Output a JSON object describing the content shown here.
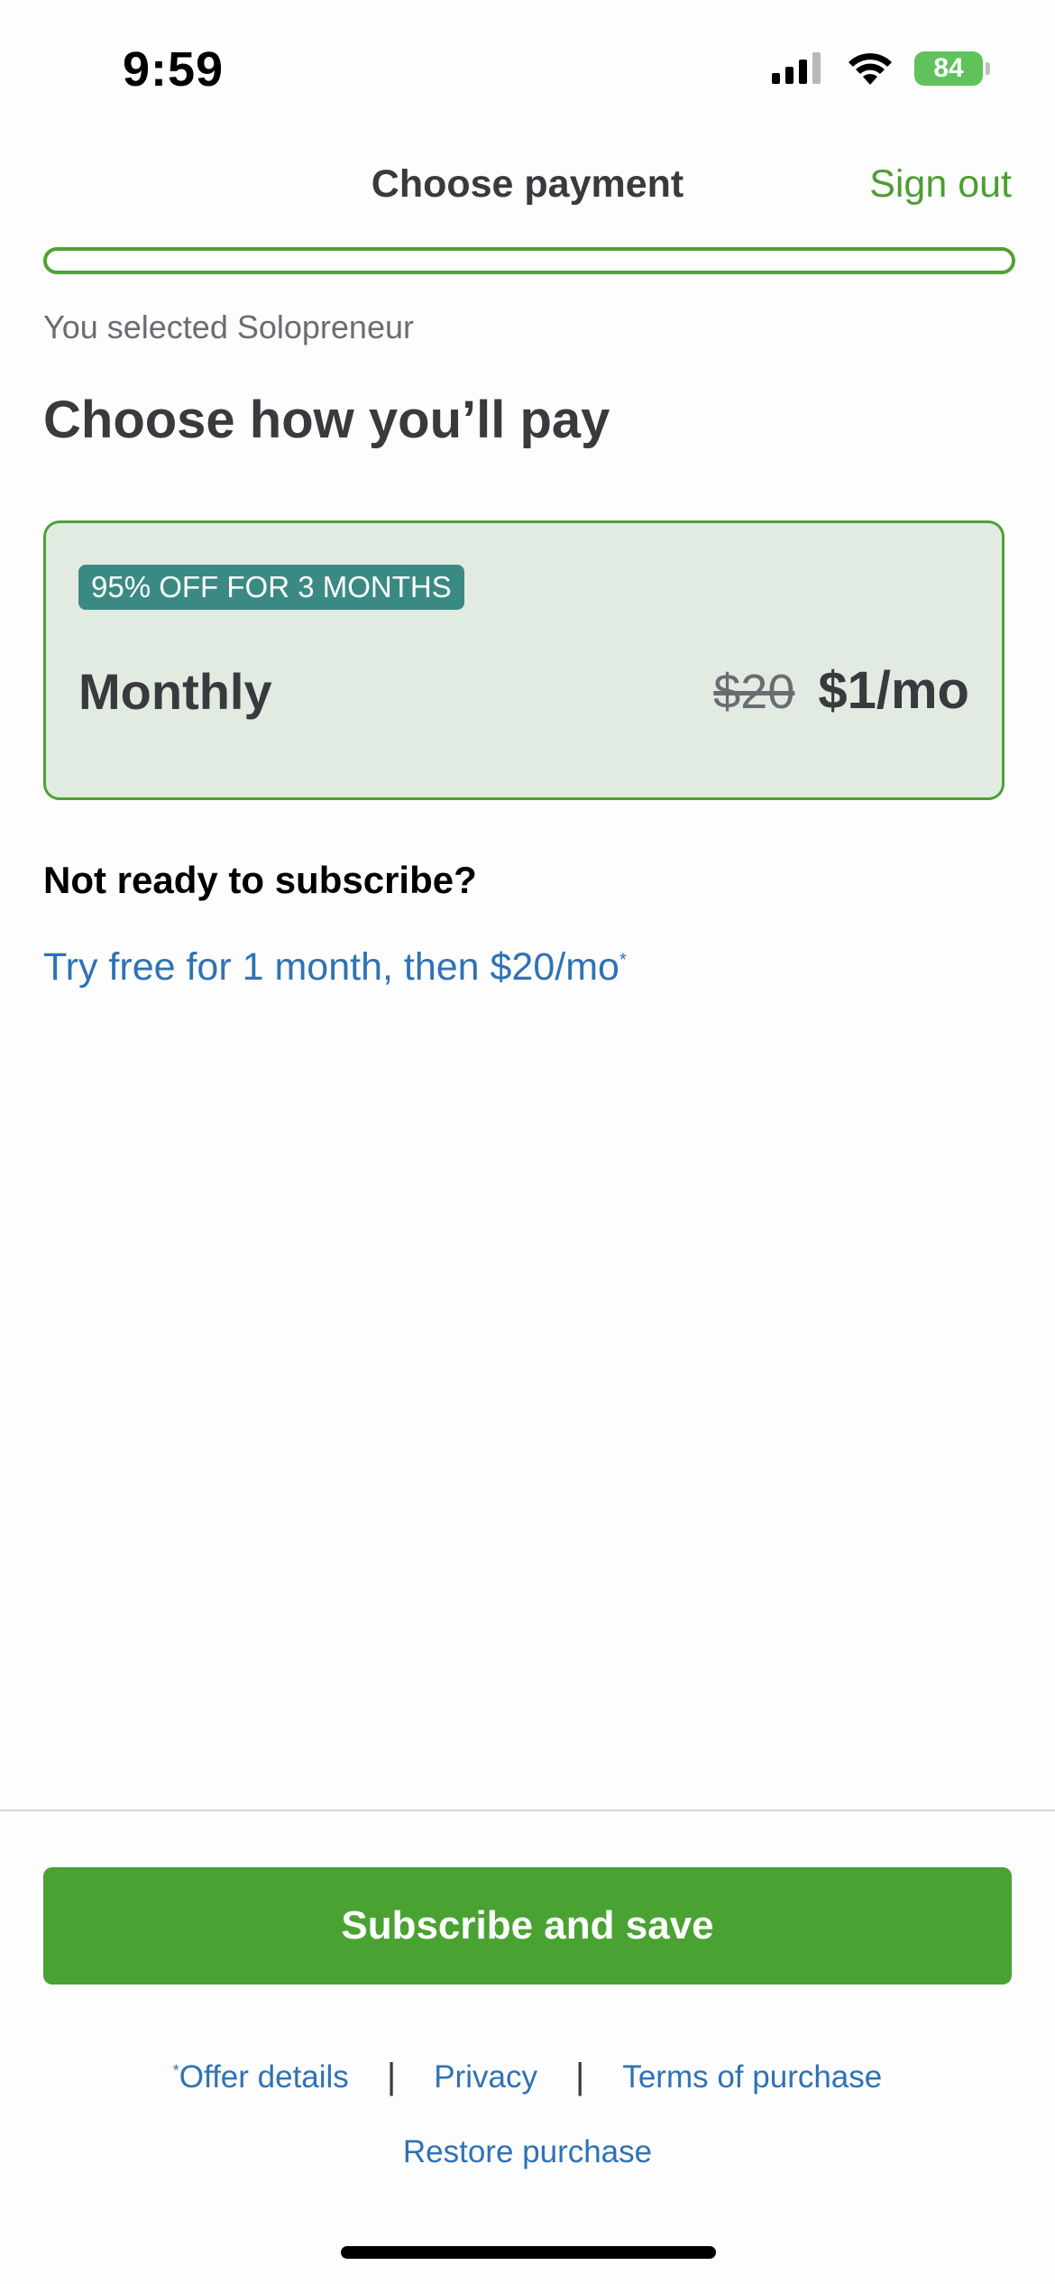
{
  "status_bar": {
    "time": "9:59",
    "battery": "84",
    "icons": [
      "cellular-signal-icon",
      "wifi-icon",
      "battery-charging-icon"
    ]
  },
  "header": {
    "title": "Choose payment",
    "sign_out": "Sign out",
    "progress_fraction": 1.0
  },
  "selection": {
    "text": "You selected Solopreneur"
  },
  "heading": "Choose how you’ll pay",
  "plan": {
    "badge": "95% OFF FOR 3 MONTHS",
    "name": "Monthly",
    "old_price": "$20",
    "new_price": "$1/mo",
    "selected": true
  },
  "trial": {
    "question": "Not ready to subscribe?",
    "link": "Try free for 1 month, then $20/mo",
    "footnote_mark": "*"
  },
  "subscribe_button": "Subscribe and save",
  "footer": {
    "offer_mark": "*",
    "offer_details": "Offer details",
    "separator": "|",
    "privacy": "Privacy",
    "terms": "Terms of purchase",
    "restore": "Restore purchase"
  },
  "colors": {
    "brand_green": "#4aa232",
    "link_blue": "#2f72b5",
    "badge_teal": "#3a8a83",
    "card_bg": "#e1ebe1",
    "text_dark": "#393a3d"
  }
}
